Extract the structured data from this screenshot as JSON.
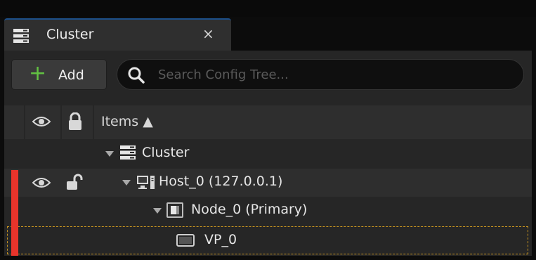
{
  "tab": {
    "title": "Cluster",
    "close": "×"
  },
  "toolbar": {
    "add_label": "Add",
    "search_placeholder": "Search Config Tree..."
  },
  "header": {
    "items_label": "Items ▲"
  },
  "tree": [
    {
      "label": "Cluster",
      "icon": "cluster-icon"
    },
    {
      "label": "Host_0 (127.0.0.1)",
      "icon": "host-icon"
    },
    {
      "label": "Node_0 (Primary)",
      "icon": "node-icon"
    },
    {
      "label": "VP_0",
      "icon": "viewport-icon"
    }
  ],
  "colors": {
    "accent_add": "#62c242",
    "marker": "#e8342b",
    "selection_outline": "#c89420"
  }
}
